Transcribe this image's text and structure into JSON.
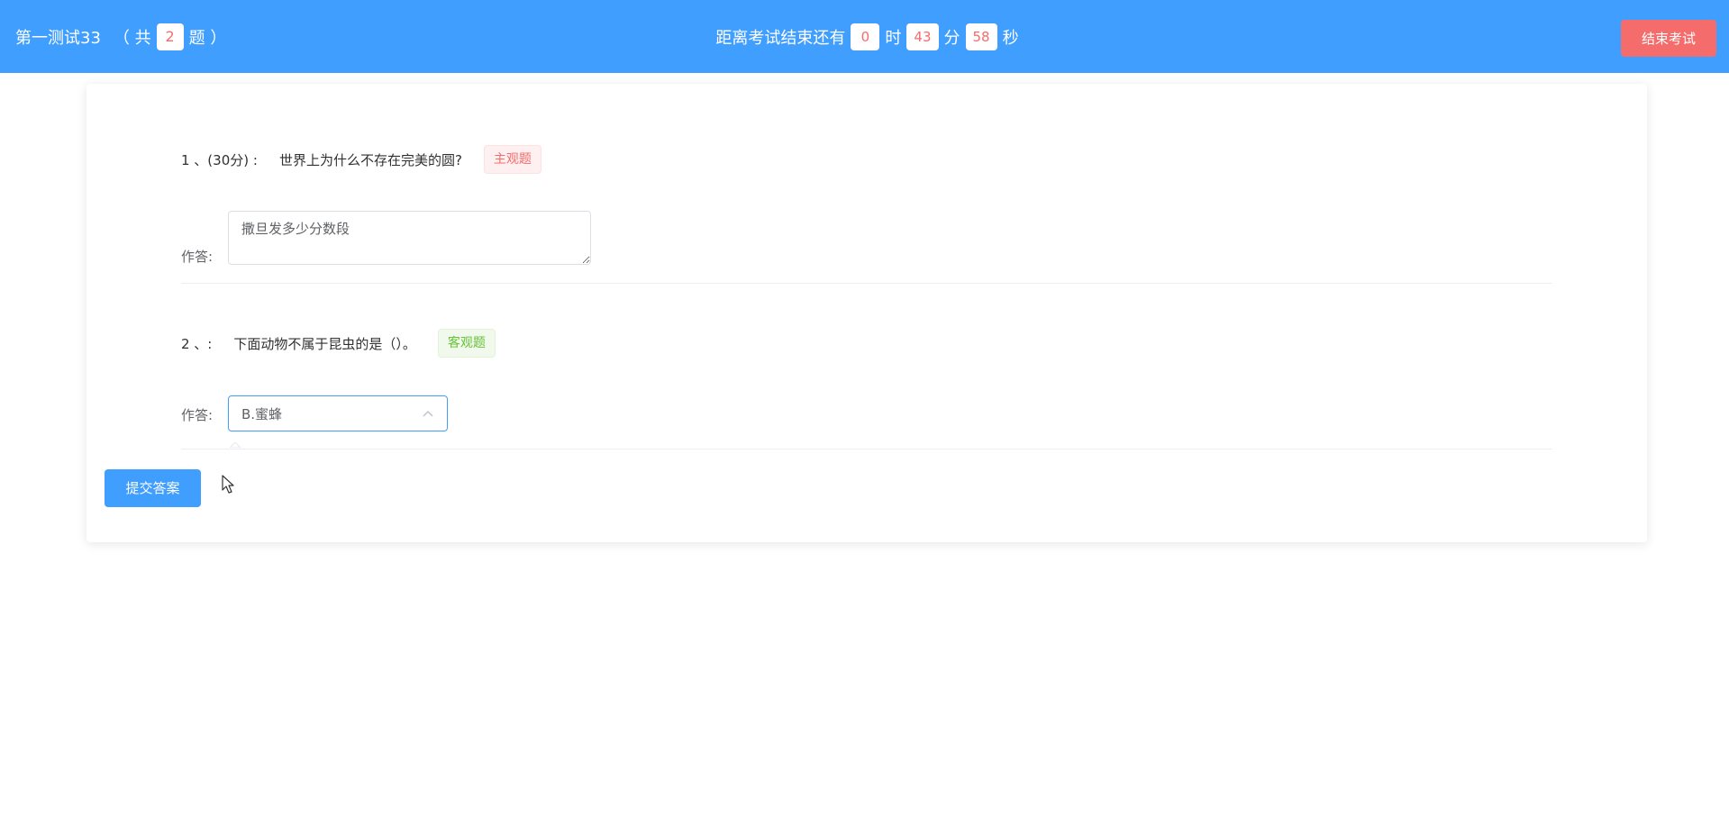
{
  "header": {
    "exam_title": "第一测试33",
    "count_prefix": "（ 共",
    "question_count": "2",
    "count_suffix": "题 ）",
    "countdown_label": "距离考试结束还有",
    "hours": "0",
    "hours_unit": "时",
    "minutes": "43",
    "minutes_unit": "分",
    "seconds": "58",
    "seconds_unit": "秒",
    "end_exam_label": "结束考试"
  },
  "questions": [
    {
      "number": "1 、(30分) :",
      "text": "世界上为什么不存在完美的圆?",
      "type_tag": "主观题",
      "answer_label": "作答:",
      "answer_value": "撒旦发多少分数段"
    },
    {
      "number": "2 、:",
      "text": "下面动物不属于昆虫的是（）。",
      "type_tag": "客观题",
      "answer_label": "作答:",
      "selected_option": "B.蜜蜂"
    }
  ],
  "actions": {
    "submit_label": "提交答案"
  },
  "colors": {
    "primary": "#409eff",
    "danger": "#f56c6c",
    "success": "#67c23a"
  },
  "icons": {
    "select_arrow": "chevron-up-icon",
    "cursor": "mouse-pointer-icon"
  }
}
